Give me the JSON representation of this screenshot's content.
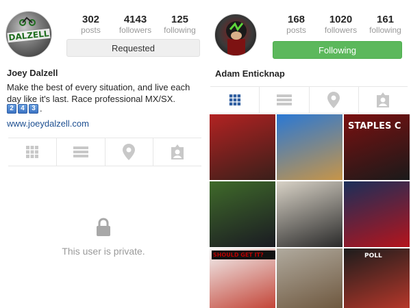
{
  "left_profile": {
    "avatar_text": "DALZELL",
    "stats": [
      {
        "value": "302",
        "label": "posts"
      },
      {
        "value": "4143",
        "label": "followers"
      },
      {
        "value": "125",
        "label": "following"
      }
    ],
    "action_label": "Requested",
    "name": "Joey Dalzell",
    "bio": "Make the best of every situation, and live each day like it's last. Race professional MX/SX.",
    "keycaps": [
      "2",
      "4",
      "3"
    ],
    "keycaps_suffix": ".",
    "website": "www.joeydalzell.com",
    "tabs": [
      "grid-icon",
      "list-icon",
      "location-pin-icon",
      "tagged-photos-icon"
    ],
    "private_message": "This user is private."
  },
  "right_profile": {
    "stats": [
      {
        "value": "168",
        "label": "posts"
      },
      {
        "value": "1020",
        "label": "followers"
      },
      {
        "value": "161",
        "label": "following"
      }
    ],
    "action_label": "Following",
    "name": "Adam Enticknap",
    "tabs": [
      "grid-icon",
      "list-icon",
      "location-pin-icon",
      "tagged-photos-icon"
    ],
    "active_tab": "grid-icon",
    "photos": [
      {
        "id": 1,
        "subject": "motocross bike in stadium",
        "colors": [
          "#b22222",
          "#3a1f1a"
        ]
      },
      {
        "id": 2,
        "subject": "riders jumping against blue sky",
        "colors": [
          "#2a78d4",
          "#c79548"
        ]
      },
      {
        "id": 3,
        "subject": "staples center arena entrance",
        "caption": "STAPLES C",
        "colors": [
          "#7a1010",
          "#1a1a1a"
        ]
      },
      {
        "id": 4,
        "subject": "rider on bike in stadium",
        "colors": [
          "#3f6a2a",
          "#1a1a22"
        ]
      },
      {
        "id": 5,
        "subject": "man lying on pillow with phone",
        "colors": [
          "#d8d2c6",
          "#2a2a2a"
        ]
      },
      {
        "id": 6,
        "subject": "two riders in team gear",
        "colors": [
          "#1a2f5a",
          "#b5141c"
        ]
      },
      {
        "id": 7,
        "subject": "poll chart screenshot",
        "caption": "SHOULD GET IT?",
        "colors": [
          "#f2f2f2",
          "#c0392b"
        ]
      },
      {
        "id": 8,
        "subject": "dirt field under cloudy sky",
        "colors": [
          "#b0aa9e",
          "#6a5238"
        ]
      },
      {
        "id": 9,
        "subject": "poll results screenshot",
        "caption": "POLL",
        "colors": [
          "#1c1c1c",
          "#c0392b"
        ]
      }
    ]
  },
  "colors": {
    "following_button": "#5cb85c",
    "requested_button": "#efefef",
    "link": "#1d4f91",
    "active_tab_icon": "#2f5ea0",
    "inactive_tab_icon": "#c8c8c8"
  }
}
